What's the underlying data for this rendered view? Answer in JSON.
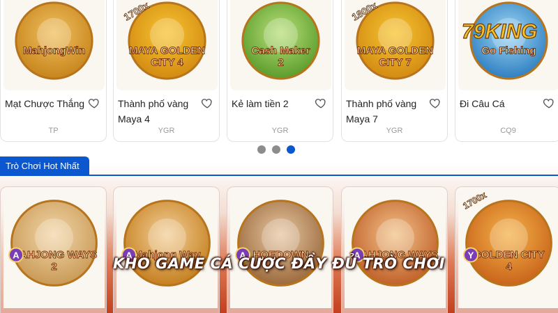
{
  "featured_games": [
    {
      "title": "Mạt Chược Thắng",
      "provider": "TP",
      "art": "MahjongWin",
      "art_colors": [
        "#f0c060",
        "#c7851c"
      ]
    },
    {
      "title": "Thành phố vàng Maya 4",
      "provider": "YGR",
      "art": "MAYA GOLDEN CITY 4",
      "badge": "1700x",
      "art_colors": [
        "#f7c531",
        "#d38b12"
      ]
    },
    {
      "title": "Kẻ làm tiền 2",
      "provider": "YGR",
      "art": "Cash Maker 2",
      "art_colors": [
        "#b9e07a",
        "#5b9c2c"
      ]
    },
    {
      "title": "Thành phố vàng Maya 7",
      "provider": "YGR",
      "art": "MAYA GOLDEN CITY 7",
      "badge": "1800x",
      "art_colors": [
        "#f7c531",
        "#d38b12"
      ]
    },
    {
      "title": "Đi Câu Cá",
      "provider": "CQ9",
      "art": "Go Fishing",
      "art_colors": [
        "#9fd7f5",
        "#2f7fc1"
      ]
    }
  ],
  "carousel": {
    "pages": 3,
    "active": 2
  },
  "hot_section": {
    "tab_label": "Trò Chơi Hot Nhất"
  },
  "hot_games": [
    {
      "art": "MAHJONG WAYS 2",
      "badge": "A",
      "art_colors": [
        "#f2d6a8",
        "#c99a57"
      ]
    },
    {
      "art": "Mahjong Way",
      "badge": "A",
      "art_colors": [
        "#f3cf9a",
        "#c5801f"
      ]
    },
    {
      "art": "HOEDOWN",
      "badge": "A",
      "art_colors": [
        "#e8c8a4",
        "#9b6a3c"
      ]
    },
    {
      "art": "MAHJONG WAYS",
      "badge": "A",
      "art_colors": [
        "#f2c38a",
        "#c1602a"
      ]
    },
    {
      "art": "GOLDEN CITY 4",
      "badge": "Y",
      "badge2": "1700x",
      "art_colors": [
        "#f5b44a",
        "#c9641b"
      ]
    }
  ],
  "watermark_logo": "79KING",
  "overlay_caption": "KHO GAME CÁ CƯỢC ĐẦY ĐỦ TRÒ CHƠI",
  "colors": {
    "accent": "#0b57d0",
    "dot_inactive": "#8c8c8c",
    "provider_text": "#999999"
  }
}
